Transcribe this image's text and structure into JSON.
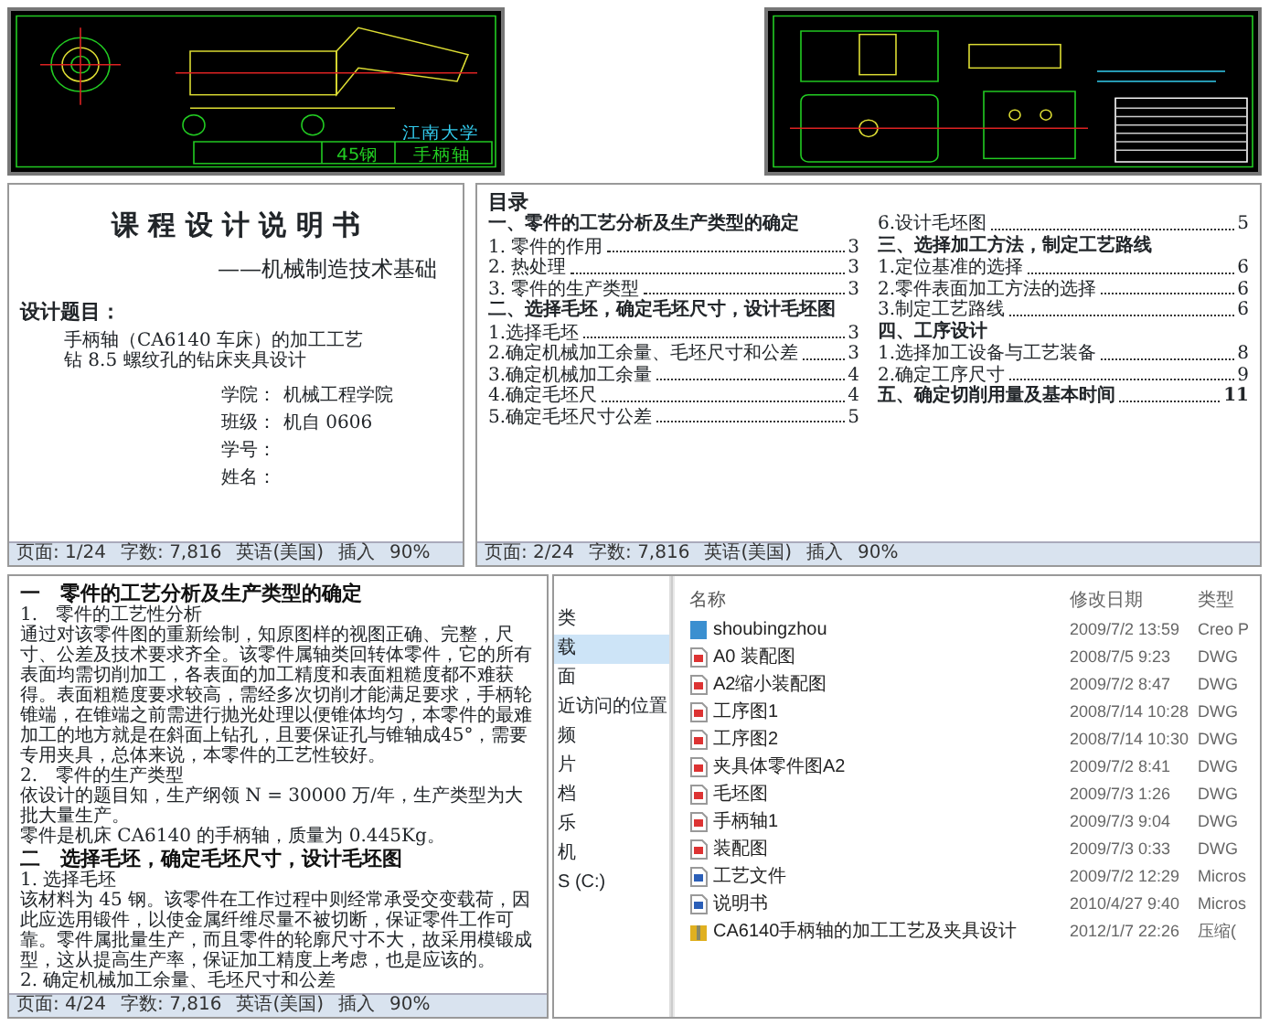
{
  "cad_drawings": [
    {
      "kind": "shaft",
      "title_block": {
        "material": "45钢",
        "school": "江南大学",
        "part_name": "手柄轴"
      }
    },
    {
      "kind": "fixture"
    }
  ],
  "cover_page": {
    "title": "课 程 设 计 说 明 书",
    "subtitle": "——机械制造技术基础",
    "topic_label": "设计题目：",
    "topics": [
      "手柄轴（CA6140 车床）的加工工艺",
      "钻 8.5 螺纹孔的钻床夹具设计"
    ],
    "fields": [
      {
        "label": "学院：",
        "value": "机械工程学院"
      },
      {
        "label": "班级：",
        "value": "机自 0606"
      },
      {
        "label": "学号："
      },
      {
        "label": "姓名："
      }
    ],
    "status_bar": [
      "页面: 1/24",
      "字数: 7,816",
      "英语(美国)",
      "插入",
      "90%"
    ]
  },
  "contents_page": {
    "title": "目录",
    "sections": [
      {
        "heading": "一、零件的工艺分析及生产类型的确定",
        "items": [
          {
            "label": "1. 零件的作用",
            "page": "3"
          },
          {
            "label": "2. 热处理",
            "page": "3"
          },
          {
            "label": "3. 零件的生产类型",
            "page": "3"
          }
        ]
      },
      {
        "heading": "二、选择毛坯，确定毛坯尺寸，设计毛坯图",
        "items": [
          {
            "label": "1.选择毛坯",
            "page": "3"
          },
          {
            "label": "2.确定机械加工余量、毛坯尺寸和公差",
            "page": "3"
          },
          {
            "label": "3.确定机械加工余量",
            "page": "4"
          },
          {
            "label": "4.确定毛坯尺",
            "page": "4"
          },
          {
            "label": "5.确定毛坯尺寸公差",
            "page": "5"
          },
          {
            "label": "6.设计毛坯图",
            "page": "5"
          }
        ]
      },
      {
        "heading": "三、选择加工方法，制定工艺路线",
        "items": [
          {
            "label": "1.定位基准的选择",
            "page": "6"
          },
          {
            "label": "2.零件表面加工方法的选择",
            "page": "6"
          },
          {
            "label": "3.制定工艺路线",
            "page": "6"
          }
        ]
      },
      {
        "heading": "四、工序设计",
        "items": [
          {
            "label": "1.选择加工设备与工艺装备",
            "page": "8"
          },
          {
            "label": "2.确定工序尺寸",
            "page": "9"
          }
        ]
      },
      {
        "heading": "五、确定切削用量及基本时间",
        "page": "11"
      }
    ],
    "status_bar": [
      "页面: 2/24",
      "字数: 7,816",
      "英语(美国)",
      "插入",
      "90%"
    ]
  },
  "body_page": {
    "blocks": [
      {
        "kind": "heading",
        "text": "一　零件的工艺分析及生产类型的确定"
      },
      {
        "kind": "subheading",
        "text": "1.　零件的工艺性分析"
      },
      {
        "kind": "paragraph",
        "text": "通过对该零件图的重新绘制，知原图样的视图正确、完整，尺寸、公差及技术要求齐全。该零件属轴类回转体零件，它的所有表面均需切削加工，各表面的加工精度和表面粗糙度都不难获得。表面粗糙度要求较高，需经多次切削才能满足要求，手柄轮锥端，在锥端之前需进行抛光处理以便锥体均匀，本零件的最难加工的地方就是在斜面上钻孔，且要保证孔与锥轴成45°，需要专用夹具，总体来说，本零件的工艺性较好。"
      },
      {
        "kind": "subheading",
        "text": "2.　零件的生产类型"
      },
      {
        "kind": "paragraph",
        "text": "依设计的题目知，生产纲领 N = 30000 万/年，生产类型为大批大量生产。"
      },
      {
        "kind": "paragraph",
        "text": "零件是机床 CA6140 的手柄轴，质量为 0.445Kg。"
      },
      {
        "kind": "heading",
        "text": "二　选择毛坯，确定毛坯尺寸，设计毛坯图"
      },
      {
        "kind": "subheading",
        "text": "1. 选择毛坯"
      },
      {
        "kind": "paragraph",
        "text": "该材料为 45 钢。该零件在工作过程中则经常承受交变载荷，因此应选用锻件，以使金属纤维尽量不被切断，保证零件工作可靠。零件属批量生产，而且零件的轮廓尺寸不大，故采用模锻成型，这从提高生产率，保证加工精度上考虑，也是应该的。"
      },
      {
        "kind": "subheading",
        "text": "2. 确定机械加工余量、毛坯尺寸和公差"
      }
    ],
    "status_bar": [
      "页面: 4/24",
      "字数: 7,816",
      "英语(美国)",
      "插入",
      "90%"
    ]
  },
  "file_explorer": {
    "nav_items": [
      {
        "label": "类",
        "selected": false
      },
      {
        "label": "载",
        "selected": true
      },
      {
        "label": "面",
        "selected": false
      },
      {
        "label": "近访问的位置",
        "selected": false
      },
      {
        "label": "频",
        "selected": false
      },
      {
        "label": "片",
        "selected": false
      },
      {
        "label": "档",
        "selected": false
      },
      {
        "label": "乐",
        "selected": false
      },
      {
        "label": "机",
        "selected": false
      },
      {
        "label": "S (C:)",
        "selected": false
      }
    ],
    "columns": [
      "名称",
      "修改日期",
      "类型"
    ],
    "files": [
      {
        "kind": "model",
        "name": "shoubingzhou",
        "modified": "2009/7/2 13:59",
        "type": "Creo P"
      },
      {
        "kind": "dwg",
        "name": "A0 装配图",
        "modified": "2008/7/5 9:23",
        "type": "DWG"
      },
      {
        "kind": "dwg",
        "name": "A2缩小装配图",
        "modified": "2009/7/2 8:47",
        "type": "DWG"
      },
      {
        "kind": "dwg",
        "name": "工序图1",
        "modified": "2008/7/14 10:28",
        "type": "DWG"
      },
      {
        "kind": "dwg",
        "name": "工序图2",
        "modified": "2008/7/14 10:30",
        "type": "DWG"
      },
      {
        "kind": "dwg",
        "name": "夹具体零件图A2",
        "modified": "2009/7/2 8:41",
        "type": "DWG"
      },
      {
        "kind": "dwg",
        "name": "毛坯图",
        "modified": "2009/7/3 1:26",
        "type": "DWG"
      },
      {
        "kind": "dwg",
        "name": "手柄轴1",
        "modified": "2009/7/3 9:04",
        "type": "DWG"
      },
      {
        "kind": "dwg",
        "name": "装配图",
        "modified": "2009/7/3 0:33",
        "type": "DWG"
      },
      {
        "kind": "word",
        "name": "工艺文件",
        "modified": "2009/7/2 12:29",
        "type": "Micros"
      },
      {
        "kind": "word",
        "name": "说明书",
        "modified": "2010/4/27 9:40",
        "type": "Micros"
      },
      {
        "kind": "zip",
        "name": "CA6140手柄轴的加工工艺及夹具设计",
        "modified": "2012/1/7 22:26",
        "type": "压缩("
      }
    ]
  }
}
